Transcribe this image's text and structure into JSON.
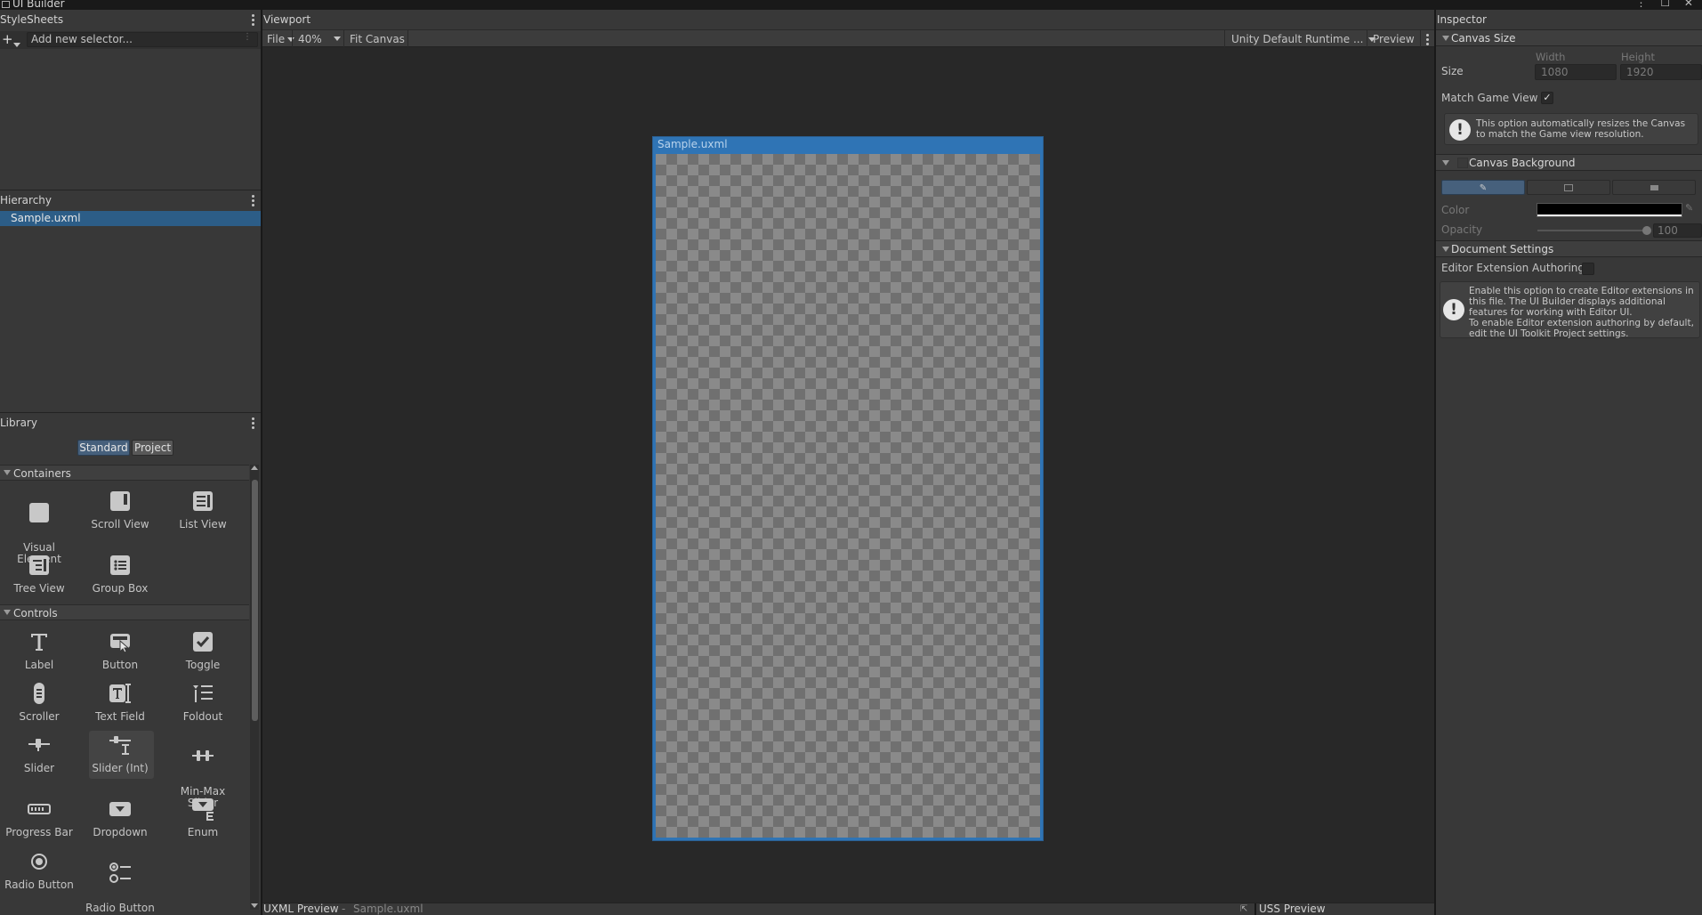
{
  "window": {
    "title": "UI Builder"
  },
  "stylesheets": {
    "title": "StyleSheets",
    "add_placeholder": "Add new selector..."
  },
  "hierarchy": {
    "title": "Hierarchy",
    "items": [
      {
        "label": "Sample.uxml",
        "selected": true
      }
    ]
  },
  "library": {
    "title": "Library",
    "tabs": [
      "Standard",
      "Project"
    ],
    "active_tab": "Standard",
    "sections": [
      {
        "label": "Containers",
        "items": [
          "Visual Element",
          "Scroll View",
          "List View",
          "Tree View",
          "Group Box"
        ]
      },
      {
        "label": "Controls",
        "items": [
          "Label",
          "Button",
          "Toggle",
          "Scroller",
          "Text Field",
          "Foldout",
          "Slider",
          "Slider (Int)",
          "Min-Max Slider",
          "Progress Bar",
          "Dropdown",
          "Enum",
          "Radio Button",
          "Radio Button Group"
        ]
      }
    ],
    "containers": {
      "visual_element": "Visual\nElement",
      "scroll_view": "Scroll View",
      "list_view": "List View",
      "tree_view": "Tree View",
      "group_box": "Group Box"
    },
    "controls": {
      "label": "Label",
      "button": "Button",
      "toggle": "Toggle",
      "scroller": "Scroller",
      "text_field": "Text Field",
      "foldout": "Foldout",
      "slider": "Slider",
      "slider_int": "Slider (Int)",
      "min_max_slider": "Min-Max\nSlider",
      "progress_bar": "Progress Bar",
      "dropdown": "Dropdown",
      "enum": "Enum",
      "radio_button": "Radio Button",
      "radio_button_group": "Radio Button\nGroup"
    }
  },
  "viewport": {
    "title": "Viewport",
    "toolbar": {
      "file": "File",
      "zoom": "40%",
      "fit_canvas": "Fit Canvas",
      "theme": "Unity Default Runtime ...",
      "preview": "Preview"
    },
    "canvas_title": "Sample.uxml"
  },
  "bottom": {
    "uxml_preview": "UXML Preview",
    "separator": "-",
    "uxml_file": "Sample.uxml",
    "uss_preview": "USS Preview"
  },
  "inspector": {
    "title": "Inspector",
    "canvas_size": {
      "header": "Canvas Size",
      "size_label": "Size",
      "width_label": "Width",
      "height_label": "Height",
      "width": "1080",
      "height": "1920",
      "match_game_view_label": "Match Game View",
      "match_game_view": true,
      "help": "This option automatically resizes the Canvas to match the Game view resolution."
    },
    "canvas_background": {
      "header": "Canvas Background",
      "color_label": "Color",
      "color": "#000000",
      "opacity_label": "Opacity",
      "opacity": "100"
    },
    "document_settings": {
      "header": "Document Settings",
      "editor_ext_label": "Editor Extension Authoring",
      "editor_ext": false,
      "help": "Enable this option to create Editor extensions in this file. The UI Builder displays additional features for working with Editor UI.\nTo enable Editor extension authoring by default, edit the UI Toolkit Project settings."
    }
  },
  "colors": {
    "accent": "#2c5d87",
    "canvas_border": "#2f74b5",
    "selection": "#2c5d87"
  }
}
